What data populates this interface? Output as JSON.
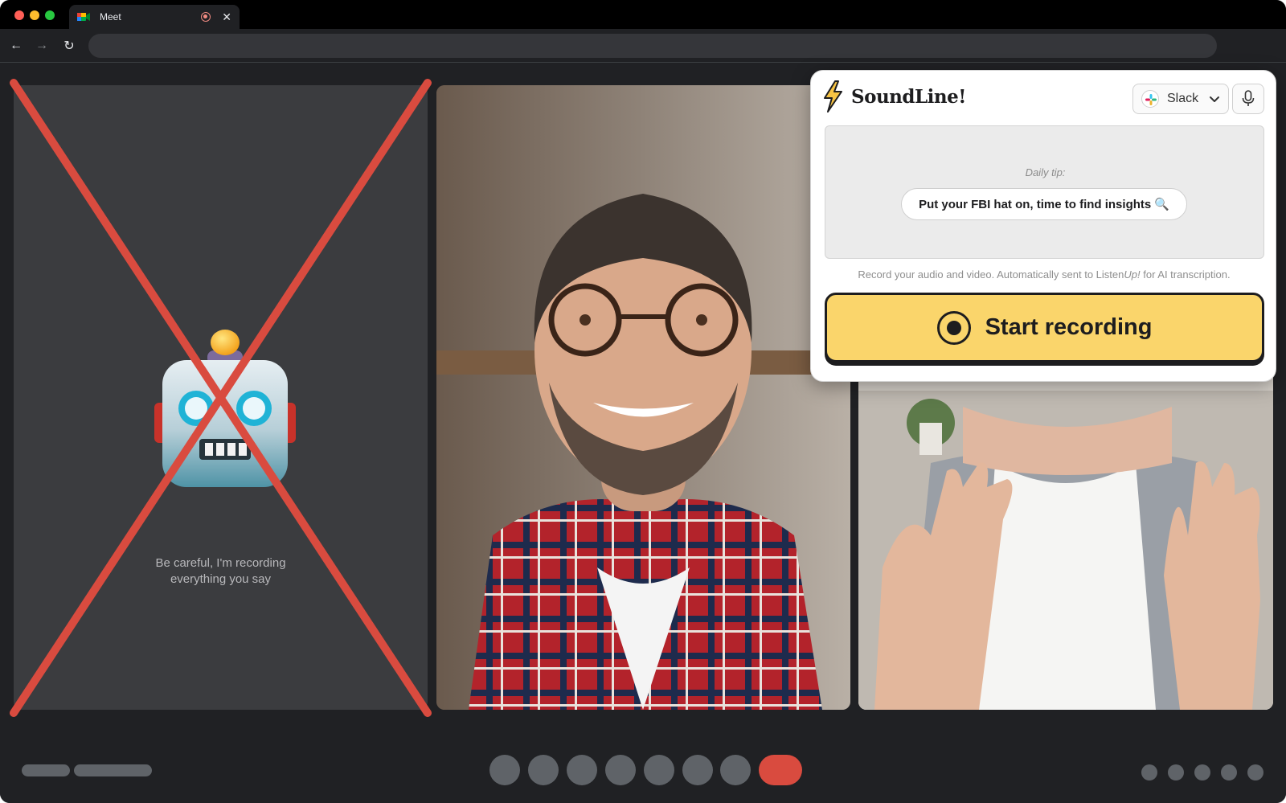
{
  "browser": {
    "tab_title": "Meet",
    "tab_close_glyph": "✕",
    "back_glyph": "←",
    "forward_glyph": "→",
    "reload_glyph": "↻"
  },
  "meeting": {
    "bot_caption_line1": "Be careful, I'm recording",
    "bot_caption_line2": "everything you say",
    "bot_icon": "robot-icon",
    "crossed_out": true,
    "participants": [
      "bot",
      "man-with-glasses",
      "woman-waving"
    ],
    "controls_count": 7,
    "right_dots_count": 5
  },
  "extension": {
    "brand_name": "SoundLine!",
    "destination": "Slack",
    "tip_heading": "Daily tip:",
    "tip_text": "Put your FBI hat on, time to find insights",
    "tip_emoji": "🔍",
    "note_prefix": "Record your audio and video. Automatically sent to Listen",
    "note_italic": "Up!",
    "note_suffix": " for AI transcription.",
    "record_label": "Start recording"
  },
  "colors": {
    "accent_yellow": "#fad56b",
    "end_call_red": "#d94b3f",
    "cross_red": "#d94b3f",
    "stage_bg": "#202124"
  }
}
